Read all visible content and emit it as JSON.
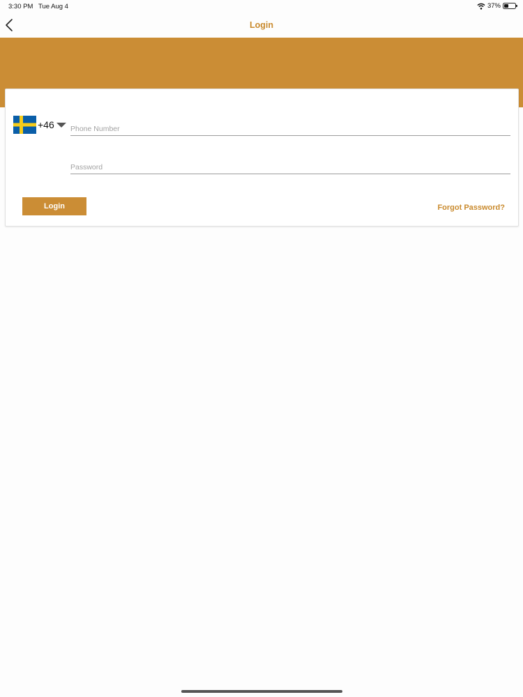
{
  "status_bar": {
    "time": "3:30 PM",
    "date": "Tue Aug 4",
    "battery_text": "37%",
    "battery_level": 0.37,
    "wifi_icon": "wifi-icon",
    "battery_icon": "battery-icon"
  },
  "nav": {
    "title": "Login",
    "back_icon": "chevron-left-icon"
  },
  "colors": {
    "accent": "#cb8d35",
    "accent_text": "#c98a2d",
    "background": "#fdfdfd",
    "flag_blue": "#0a5ea8",
    "flag_yellow": "#f7cc1a"
  },
  "login_form": {
    "country": {
      "flag_icon": "sweden-flag-icon",
      "dial_code": "+46",
      "dropdown_icon": "caret-down-icon"
    },
    "phone": {
      "placeholder": "Phone Number",
      "value": ""
    },
    "password": {
      "placeholder": "Password",
      "value": ""
    },
    "login_label": "Login",
    "forgot_password_label": "Forgot Password?"
  }
}
